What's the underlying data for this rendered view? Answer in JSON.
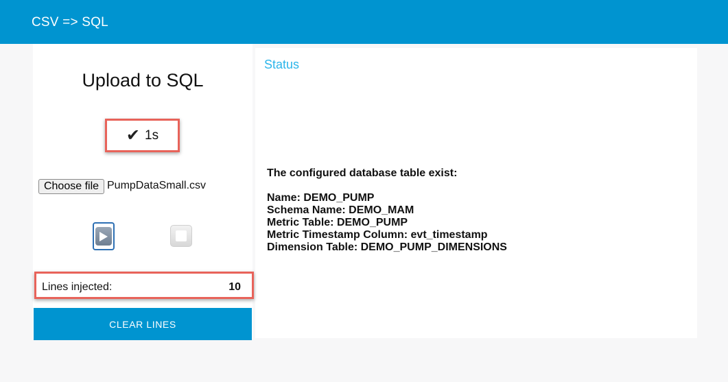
{
  "app": {
    "title": "CSV => SQL"
  },
  "upload": {
    "heading": "Upload to SQL",
    "check_glyph": "✔",
    "elapsed": "1s",
    "file_button": "Choose file",
    "file_name": "PumpDataSmall.csv",
    "lines_label": "Lines injected:",
    "lines_value": "10",
    "clear_button": "CLEAR LINES"
  },
  "status": {
    "title": "Status",
    "header": "The configured database table exist:",
    "lines": [
      "Name: DEMO_PUMP",
      "Schema Name: DEMO_MAM",
      "Metric Table: DEMO_PUMP",
      "Metric Timestamp Column: evt_timestamp",
      "Dimension Table: DEMO_PUMP_DIMENSIONS"
    ]
  },
  "colors": {
    "appbar": "#0094d0",
    "accent": "#2bb5ea",
    "highlight_border": "#e8635a"
  }
}
